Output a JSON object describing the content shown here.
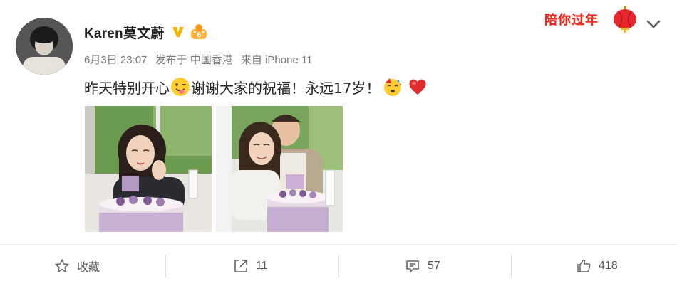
{
  "header": {
    "username": "Karen莫文蔚",
    "date": "6月3日 23:07",
    "posted_from": "发布于 中国香港",
    "device": "来自 iPhone 11"
  },
  "promo": {
    "label": "陪你过年"
  },
  "post": {
    "text_1": "昨天特别开心",
    "text_2": "谢谢大家的祝福！永远17岁！"
  },
  "actions": {
    "favorite_label": "收藏",
    "repost_count": "11",
    "comment_count": "57",
    "like_count": "418"
  },
  "icons": {
    "verified": "verified-v-icon",
    "member": "crown-icon",
    "more": "chevron-down-icon",
    "favorite": "star-icon",
    "repost": "share-arrow-icon",
    "comment": "comment-bubble-icon",
    "like": "thumbs-up-icon"
  },
  "colors": {
    "verified": "#f3b400",
    "promo_red": "#e8262d",
    "heart": "#e02e2e"
  }
}
